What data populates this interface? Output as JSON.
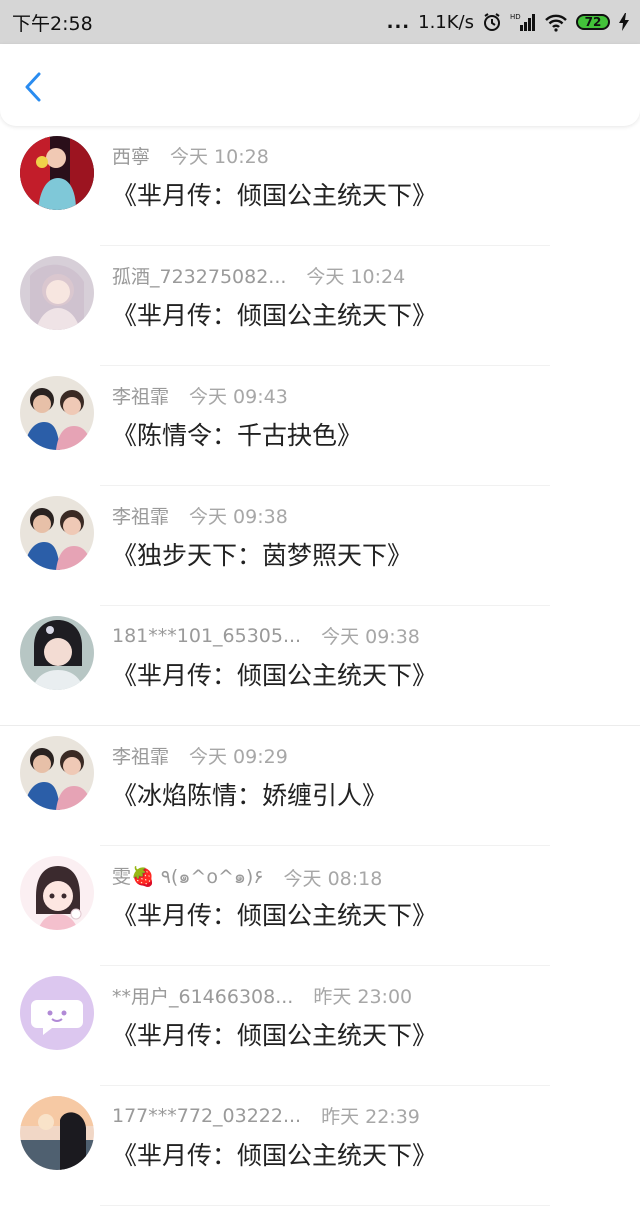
{
  "status_bar": {
    "time": "下午2:58",
    "dots": "...",
    "speed": "1.1K/s",
    "hd": "HD",
    "battery": "72"
  },
  "colors": {
    "accent": "#2a8cf0",
    "status_bar_bg": "#d6d6d6",
    "battery_green": "#43c23a"
  },
  "comments": [
    {
      "user": "西寧",
      "time": "今天 10:28",
      "title": "《芈月传：倾国公主统天下》"
    },
    {
      "user": "孤酒_723275082...",
      "time": "今天 10:24",
      "title": "《芈月传：倾国公主统天下》"
    },
    {
      "user": "李祖霏",
      "time": "今天 09:43",
      "title": "《陈情令：千古抉色》"
    },
    {
      "user": "李祖霏",
      "time": "今天 09:38",
      "title": "《独步天下：茵梦照天下》"
    },
    {
      "user": "181***101_65305...",
      "time": "今天 09:38",
      "title": "《芈月传：倾国公主统天下》"
    },
    {
      "user": "李祖霏",
      "time": "今天 09:29",
      "title": "《冰焰陈情：娇缠引人》"
    },
    {
      "user": "雯🍓 ٩(๑^o^๑)۶",
      "time": "今天 08:18",
      "title": "《芈月传：倾国公主统天下》"
    },
    {
      "user": "**用户_61466308...",
      "time": "昨天 23:00",
      "title": "《芈月传：倾国公主统天下》"
    },
    {
      "user": "177***772_03222...",
      "time": "昨天 22:39",
      "title": "《芈月传：倾国公主统天下》"
    }
  ]
}
